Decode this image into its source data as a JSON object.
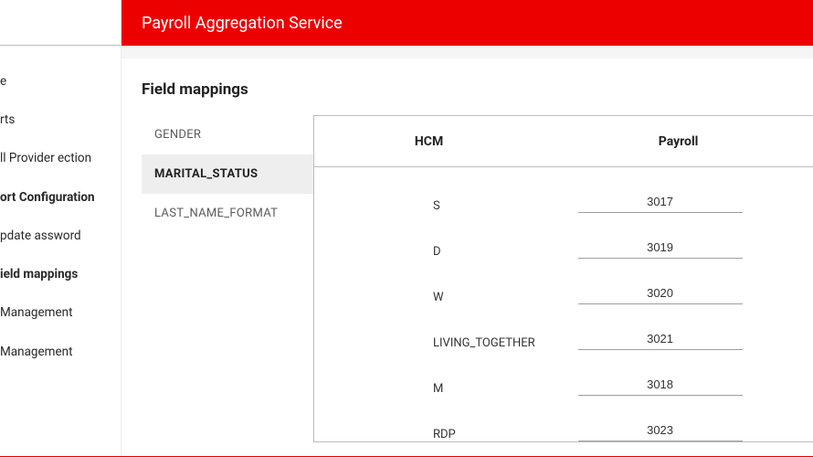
{
  "header": {
    "title": "Payroll Aggregation Service"
  },
  "sidebar": {
    "items": [
      {
        "label": "e",
        "bold": false
      },
      {
        "label": "rts",
        "bold": false
      },
      {
        "label": "ll Provider ection",
        "bold": false
      },
      {
        "label": "ort Configuration",
        "bold": true
      },
      {
        "label": "pdate assword",
        "bold": false
      },
      {
        "label": "ield mappings",
        "bold": true
      },
      {
        "label": "Management",
        "bold": false
      },
      {
        "label": "Management",
        "bold": false
      }
    ]
  },
  "main": {
    "section_title": "Field mappings",
    "tabs": [
      {
        "id": "gender",
        "label": "GENDER",
        "selected": false
      },
      {
        "id": "marital_status",
        "label": "MARITAL_STATUS",
        "selected": true
      },
      {
        "id": "last_name_format",
        "label": "LAST_NAME_FORMAT",
        "selected": false
      }
    ],
    "table": {
      "headers": {
        "left": "HCM",
        "right": "Payroll"
      },
      "rows": [
        {
          "hcm": "S",
          "payroll": "3017"
        },
        {
          "hcm": "D",
          "payroll": "3019"
        },
        {
          "hcm": "W",
          "payroll": "3020"
        },
        {
          "hcm": "LIVING_TOGETHER",
          "payroll": "3021"
        },
        {
          "hcm": "M",
          "payroll": "3018"
        },
        {
          "hcm": "RDP",
          "payroll": "3023"
        }
      ]
    }
  }
}
